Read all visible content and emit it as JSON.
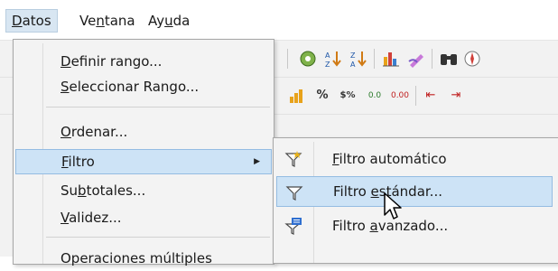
{
  "menubar": {
    "items": [
      {
        "pre": "",
        "u": "D",
        "post": "atos"
      },
      {
        "pre": "Ve",
        "u": "n",
        "post": "tana"
      },
      {
        "pre": "Ay",
        "u": "u",
        "post": "da"
      }
    ]
  },
  "toolbar": {
    "row1": [
      "gallery-icon",
      "sort-ascending-icon",
      "sort-descending-icon",
      "chart-icon",
      "pencil-icon",
      "binoculars-icon",
      "navigator-icon"
    ],
    "row2": [
      {
        "icon": "currency-icon",
        "text": ""
      },
      {
        "icon": "percent-icon",
        "text": "%"
      },
      {
        "icon": "number-format-icon",
        "text": "$%"
      },
      {
        "icon": "add-decimal-icon",
        "text": "0.0"
      },
      {
        "icon": "delete-decimal-icon",
        "text": "0.00"
      },
      {
        "icon": "decrease-indent-icon",
        "text": "⇤"
      },
      {
        "icon": "increase-indent-icon",
        "text": "⇥"
      }
    ]
  },
  "menu": {
    "items": [
      {
        "pre": "",
        "u": "D",
        "post": "efinir rango..."
      },
      {
        "pre": "",
        "u": "S",
        "post": "eleccionar Rango..."
      },
      {
        "pre": "",
        "u": "O",
        "post": "rdenar..."
      },
      {
        "pre": "",
        "u": "F",
        "post": "iltro"
      },
      {
        "pre": "Su",
        "u": "b",
        "post": "totales..."
      },
      {
        "pre": "",
        "u": "V",
        "post": "alidez..."
      },
      {
        "pre": "Operaciones múltiples",
        "u": "",
        "post": ""
      }
    ]
  },
  "submenu": {
    "items": [
      {
        "pre": "",
        "u": "F",
        "post": "iltro automático"
      },
      {
        "pre": "Filtro ",
        "u": "e",
        "post": "stándar..."
      },
      {
        "pre": "Filtro ",
        "u": "a",
        "post": "vanzado..."
      }
    ]
  },
  "colors": {
    "highlight": "#cde3f6",
    "highlight_border": "#94bce2",
    "menu_bg": "#f3f3f3"
  }
}
